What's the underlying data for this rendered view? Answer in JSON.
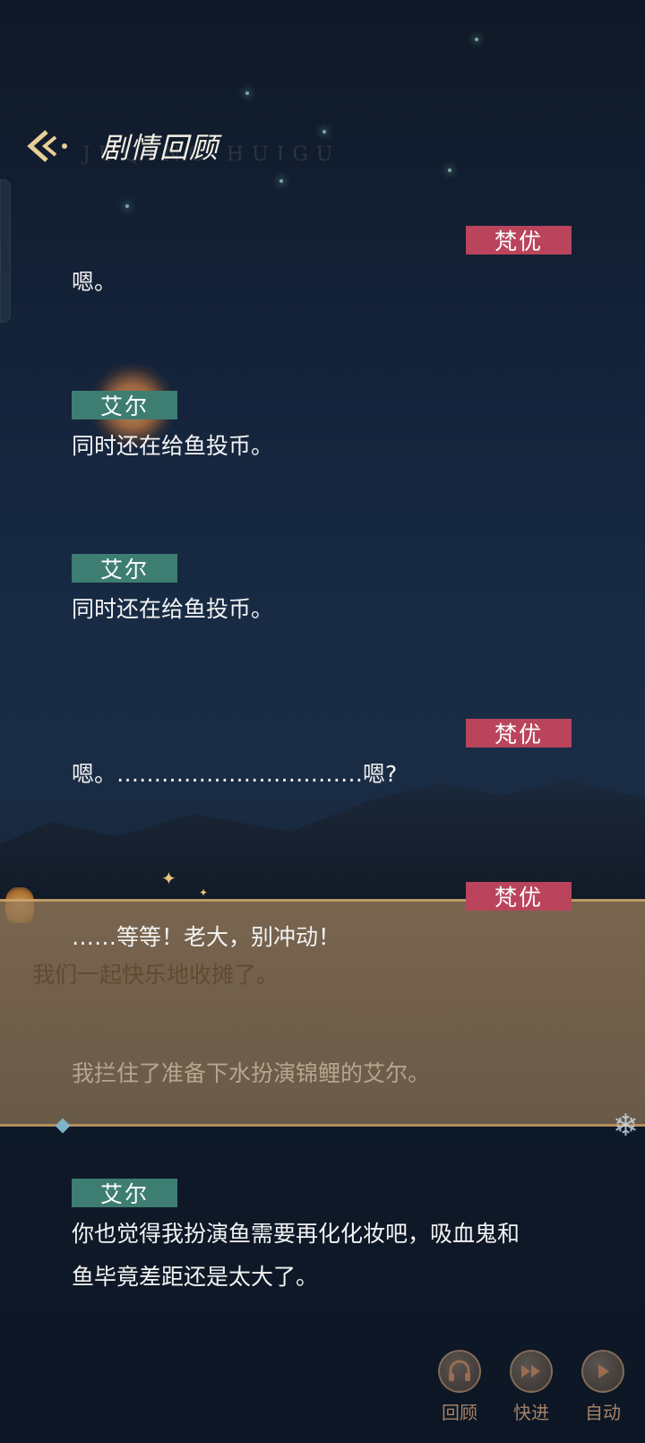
{
  "header": {
    "title": "剧情回顾",
    "watermark": "JUQING HUIGU"
  },
  "colors": {
    "speaker_fanyou": "#b9445c",
    "speaker_aier": "#3d7d72"
  },
  "entries": [
    {
      "speaker": "梵优",
      "side": "right",
      "text": "嗯。"
    },
    {
      "speaker": "艾尔",
      "side": "left",
      "text": "同时还在给鱼投币。"
    },
    {
      "speaker": "艾尔",
      "side": "left",
      "text": "同时还在给鱼投币。"
    },
    {
      "speaker": "梵优",
      "side": "right",
      "text": "嗯。……………………………嗯?"
    },
    {
      "speaker": "梵优",
      "side": "right",
      "text": "……等等！老大，别冲动！"
    },
    {
      "speaker": "艾尔",
      "side": "left",
      "text": "你也觉得我扮演鱼需要再化化妆吧，吸血鬼和",
      "text2": "鱼毕竟差距还是太大了。"
    }
  ],
  "dialog_box": {
    "line1": "我们一起快乐地收摊了。",
    "line2": "我拦住了准备下水扮演锦鲤的艾尔。"
  },
  "controls": {
    "review": "回顾",
    "fast_forward": "快进",
    "auto": "自动"
  },
  "icons": {
    "back": "back-arrow-icon",
    "review": "headphone-icon",
    "fast_forward": "fast-forward-icon",
    "auto": "play-icon"
  }
}
